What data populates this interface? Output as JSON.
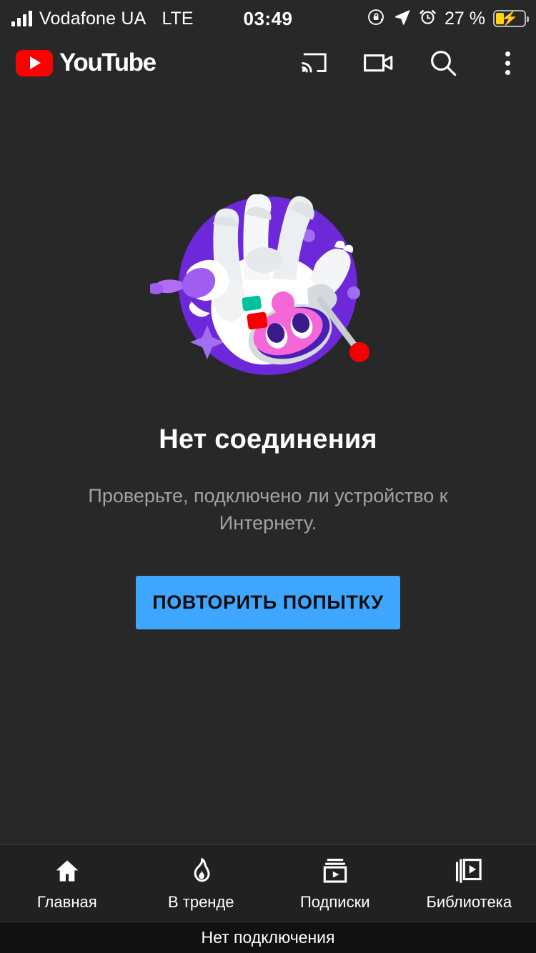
{
  "statusbar": {
    "carrier": "Vodafone UA",
    "network": "LTE",
    "clock": "03:49",
    "battery_percent": "27 %",
    "icons": [
      "signal-bars-icon",
      "rotation-lock-icon",
      "location-arrow-icon",
      "alarm-clock-icon",
      "battery-charging-icon"
    ]
  },
  "header": {
    "logo_text": "YouTube",
    "actions": [
      "cast-icon",
      "video-camera-icon",
      "search-icon",
      "more-options-icon"
    ]
  },
  "main": {
    "illustration": "offline-cow-illustration",
    "title": "Нет соединения",
    "description": "Проверьте, подключено ли устройство к Интернету.",
    "retry_label": "ПОВТОРИТЬ ПОПЫТКУ"
  },
  "bottom_nav": {
    "items": [
      {
        "label": "Главная",
        "icon": "home-icon"
      },
      {
        "label": "В тренде",
        "icon": "flame-icon"
      },
      {
        "label": "Подписки",
        "icon": "subscriptions-icon"
      },
      {
        "label": "Библиотека",
        "icon": "library-icon"
      }
    ]
  },
  "toast": {
    "message": "Нет подключения"
  },
  "colors": {
    "background": "#282828",
    "nav_background": "#212121",
    "toast_background": "#111111",
    "accent_button": "#3ea6ff",
    "brand_red": "#ff0000",
    "illustration_purple": "#6c28d9",
    "muted_text": "#a3a3a3",
    "battery_fill": "#ffd60a"
  }
}
